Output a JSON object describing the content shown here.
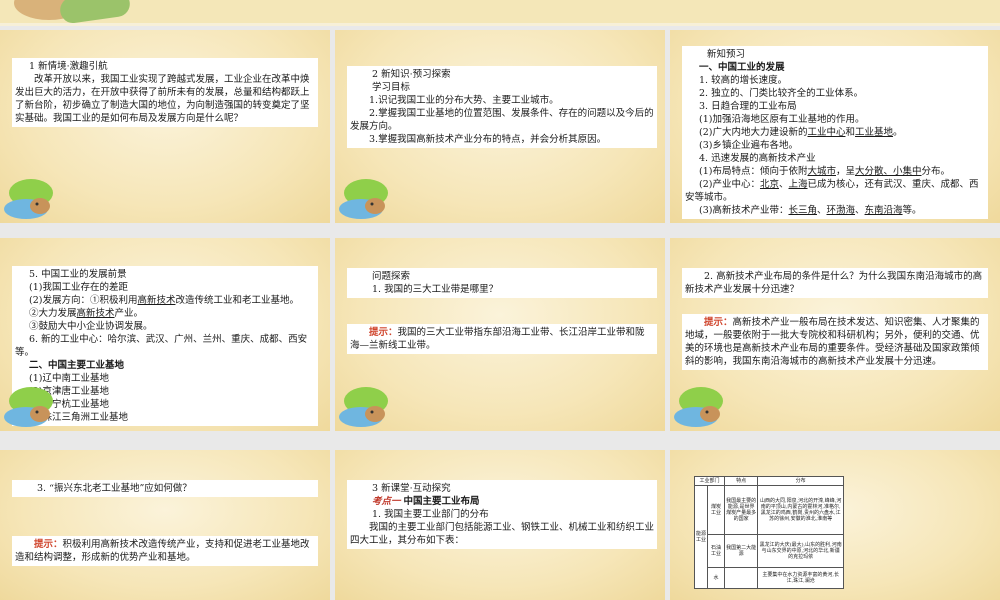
{
  "s1": {
    "heading": "1 新情境·激趣引航",
    "body": "改革开放以来，我国工业实现了跨越式发展，工业企业在改革中焕发出巨大的活力，在开放中获得了前所未有的发展，总量和结构都跃上了新台阶，初步确立了制造大国的地位，为向制造强国的转变奠定了坚实基础。我国工业的是如何布局及发展方向是什么呢？"
  },
  "s2": {
    "heading": "2 新知识·预习探索",
    "sub": "学习目标",
    "goals": [
      "1.识记我国工业的分布大势、主要工业城市。",
      "2.掌握我国工业基地的位置范围、发展条件、存在的问题以及今后的发展方向。",
      "3.掌握我国高新技术产业分布的特点，并会分析其原因。"
    ]
  },
  "s3": {
    "title": "新知预习",
    "section": "一、中国工业的发展",
    "items": [
      "1. 较高的增长速度。",
      "2. 独立的、门类比较齐全的工业体系。",
      "3. 日趋合理的工业布局",
      "(1)加强沿海地区原有工业基地的作用。"
    ],
    "l5a": "(2)广大内地大力建设新的",
    "l5u1": "工业中心",
    "l5b": "和",
    "l5u2": "工业基地",
    "l5c": "。",
    "l6": "(3)乡镇企业遍布各地。",
    "l7": "4. 迅速发展的高新技术产业",
    "l8a": "(1)布局特点：倾向于依附",
    "l8u1": "大城市",
    "l8b": "，呈",
    "l8u2": "大分散、小集中",
    "l8c": "分布。",
    "l9a": "(2)产业中心：",
    "l9u1": "北京",
    "l9b": "、",
    "l9u2": "上海",
    "l9c": "已成为核心，还有武汉、重庆、成都、西安等城市。",
    "l10a": "(3)高新技术产业带：",
    "l10u1": "长三角",
    "l10b": "、",
    "l10u2": "环渤海",
    "l10c": "、",
    "l10u3": "东南沿海",
    "l10d": "等。"
  },
  "s4": {
    "l1": "5. 中国工业的发展前景",
    "l2": "(1)我国工业存在的差距",
    "l3a": "(2)发展方向：①积极利用",
    "l3u": "高新技术",
    "l3b": "改造传统工业和老工业基地。",
    "l4a": "②大力发展",
    "l4u": "高新技术",
    "l4b": "产业。",
    "l5": "③鼓励大中小企业协调发展。",
    "l6": "6. 新的工业中心：哈尔滨、武汉、广州、兰州、重庆、成都、西安等。",
    "section": "二、中国主要工业基地",
    "bases": [
      "(1)辽中南工业基地",
      "(2)京津唐工业基地",
      "(3)沪宁杭工业基地",
      "(4)珠江三角洲工业基地"
    ]
  },
  "s5": {
    "title": "问题探索",
    "q": "1. 我国的三大工业带是哪里？",
    "hint": "提示：",
    "answer": "我国的三大工业带指东部沿海工业带、长江沿岸工业带和陇海—兰新线工业带。"
  },
  "s6": {
    "q": "2. 高新技术产业布局的条件是什么？为什么我国东南沿海城市的高新技术产业发展十分迅速？",
    "hint": "提示：",
    "answer": "高新技术产业一般布局在技术发达、知识密集、人才聚集的地域，一般要依附于一批大专院校和科研机构；另外，便利的交通、优美的环境也是高新技术产业布局的重要条件。受经济基础及国家政策倾斜的影响，我国东南沿海城市的高新技术产业发展十分迅速。"
  },
  "s7": {
    "q": "3. “振兴东北老工业基地”应如何做？",
    "hint": "提示：",
    "answer": "积极利用高新技术改造传统产业，支持和促进老工业基地改造和结构调整，形成新的优势产业和基地。"
  },
  "s8": {
    "heading": "3 新课堂·互动探究",
    "kp_label": "考点一",
    "kp_title": "中国主要工业布局",
    "l1": "1. 我国主要工业部门的分布",
    "l2": "我国的主要工业部门包括能源工业、钢铁工业、机械工业和纺织工业四大工业，其分布如下表："
  },
  "s9": {
    "headers": [
      "工业部门",
      "特点",
      "分布"
    ],
    "group": "能源工业",
    "rows": [
      {
        "sub": "煤炭工业",
        "feature": "我国最主要的能源,是世界煤炭产量最多的国家",
        "dist": "山西的大同,阳泉,河北的开滦,峰峰,河南的平顶山,内蒙古的霍林河,准格尔,黑龙江的鸡西,鹤岗,贵州的六盘水,江苏的徐州,安徽的淮北,淮南等"
      },
      {
        "sub": "石油工业",
        "feature": "我国第二大能源",
        "dist": "黑龙江的大庆(最大),山东的胜利,河南与山东交界的中原,河北的华北,新疆的克拉玛依"
      },
      {
        "sub": "水",
        "feature": "",
        "dist": "主要集中在水力资源丰富的黄河,长江,珠江,澜沧"
      }
    ]
  },
  "colors": {
    "hint": "#d0462e",
    "slide_bg": "#f6e6b8",
    "gap": "#e9e9e9"
  }
}
